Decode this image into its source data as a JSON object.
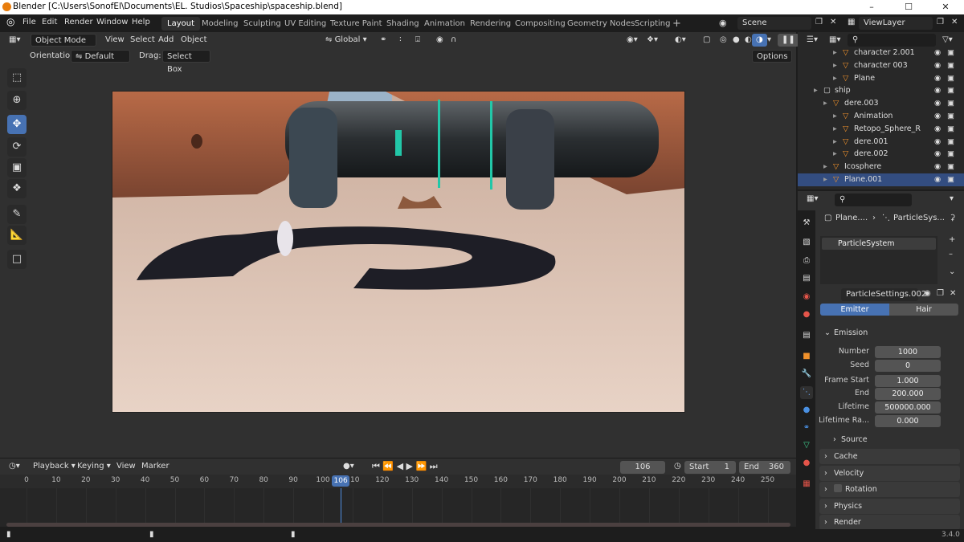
{
  "window": {
    "title": "Blender [C:\\Users\\SonofEl\\Documents\\EL. Studios\\Spaceship\\spaceship.blend]"
  },
  "menu": [
    "File",
    "Edit",
    "Render",
    "Window",
    "Help"
  ],
  "workspaces": [
    "Layout",
    "Modeling",
    "Sculpting",
    "UV Editing",
    "Texture Paint",
    "Shading",
    "Animation",
    "Rendering",
    "Compositing",
    "Geometry Nodes",
    "Scripting"
  ],
  "scene": "Scene",
  "view_layer": "ViewLayer",
  "viewport": {
    "mode": "Object Mode",
    "menus": [
      "View",
      "Select",
      "Add",
      "Object"
    ],
    "transform": "Global",
    "orientation_label": "Orientation:",
    "orientation": "Default",
    "drag_label": "Drag:",
    "drag": "Select Box",
    "options": "Options"
  },
  "timeline": {
    "menus": [
      "Playback",
      "Keying",
      "View",
      "Marker"
    ],
    "current_frame": "106",
    "start_label": "Start",
    "start": "1",
    "end_label": "End",
    "end": "360",
    "ticks": [
      "0",
      "10",
      "20",
      "30",
      "40",
      "50",
      "60",
      "70",
      "80",
      "90",
      "100",
      "110",
      "120",
      "130",
      "140",
      "150",
      "160",
      "170",
      "180",
      "190",
      "200",
      "210",
      "220",
      "230",
      "240",
      "250"
    ],
    "playhead": "106"
  },
  "outliner": {
    "rows": [
      {
        "name": "character 2.001",
        "indent": 3
      },
      {
        "name": "character 003",
        "indent": 3
      },
      {
        "name": "Plane",
        "indent": 3
      },
      {
        "name": "ship",
        "indent": 1
      },
      {
        "name": "dere.003",
        "indent": 2
      },
      {
        "name": "Animation",
        "indent": 3
      },
      {
        "name": "Retopo_Sphere_R",
        "indent": 3
      },
      {
        "name": "dere.001",
        "indent": 3
      },
      {
        "name": "dere.002",
        "indent": 3
      },
      {
        "name": "Icosphere",
        "indent": 2
      },
      {
        "name": "Plane.001",
        "indent": 2
      }
    ]
  },
  "properties": {
    "breadcrumb_object": "Plane....",
    "breadcrumb_system": "ParticleSys...",
    "particle_system": "ParticleSystem",
    "settings": "ParticleSettings.002",
    "type_tabs": [
      "Emitter",
      "Hair"
    ],
    "emission_label": "Emission",
    "fields": [
      {
        "label": "Number",
        "value": "1000"
      },
      {
        "label": "Seed",
        "value": "0"
      },
      {
        "label": "Frame Start",
        "value": "1.000"
      },
      {
        "label": "End",
        "value": "200.000"
      },
      {
        "label": "Lifetime",
        "value": "500000.000"
      },
      {
        "label": "Lifetime Ra...",
        "value": "0.000"
      }
    ],
    "source_label": "Source",
    "panels": [
      "Cache",
      "Velocity",
      "Rotation",
      "Physics",
      "Render"
    ]
  },
  "status": {
    "version": "3.4.0"
  }
}
